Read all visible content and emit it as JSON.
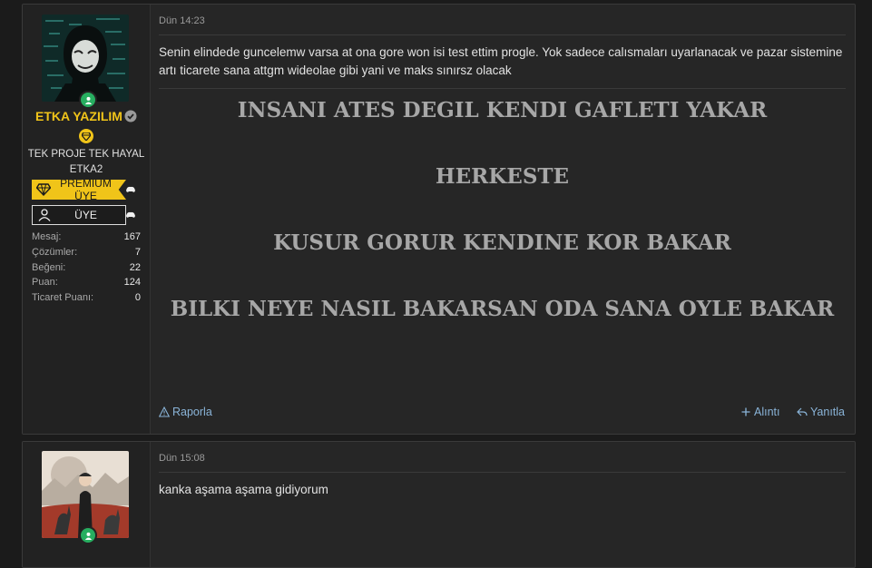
{
  "posts": [
    {
      "user": {
        "name": "ETKA YAZILIM",
        "title_line1": "TEK PROJE TEK HAYAL",
        "title_line2": "ETKA2",
        "banners": [
          "PREMIUM ÜYE",
          "ÜYE"
        ],
        "stats": [
          {
            "label": "Mesaj:",
            "value": "167"
          },
          {
            "label": "Çözümler:",
            "value": "7"
          },
          {
            "label": "Beğeni:",
            "value": "22"
          },
          {
            "label": "Puan:",
            "value": "124"
          },
          {
            "label": "Ticaret Puanı:",
            "value": "0"
          }
        ]
      },
      "date": "Dün 14:23",
      "message": "Senin elindede guncelemw varsa at ona gore won isi test ettim progle. Yok sadece calısmaları uyarlanacak ve pazar sistemine artı ticarete sana attgm wideolae gibi yani ve maks sınırsz olacak",
      "signature": [
        "INSANI ATES DEGIL KENDI GAFLETI YAKAR",
        "HERKESTE",
        "KUSUR GORUR KENDINE KOR BAKAR",
        "BILKI NEYE NASIL BAKARSAN ODA SANA OYLE BAKAR"
      ],
      "actions": {
        "report": "Raporla",
        "quote": "Alıntı",
        "reply": "Yanıtla"
      }
    },
    {
      "date": "Dün 15:08",
      "message": "kanka aşama aşama gidiyorum"
    }
  ],
  "colors": {
    "accent": "#f0c419",
    "link": "#8ab4d8",
    "online": "#27ae60"
  }
}
